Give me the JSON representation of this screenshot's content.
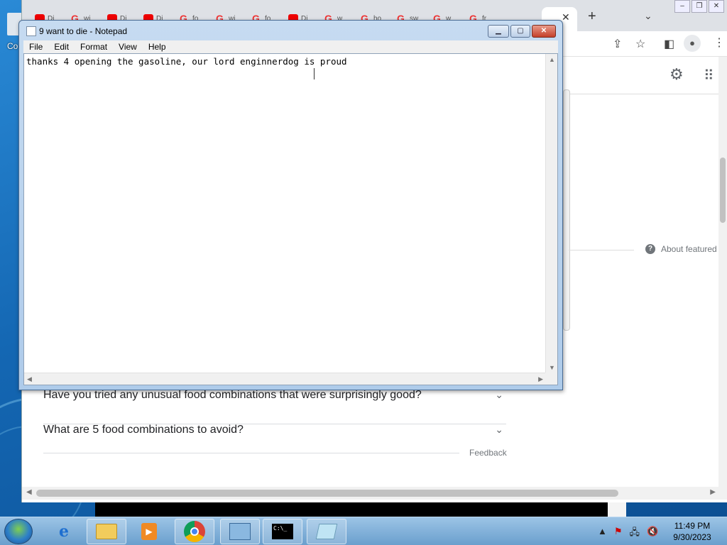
{
  "desktop": {
    "icon_label": "Co"
  },
  "chrome": {
    "tabs": [
      {
        "favicon": "youtube",
        "label": "Di"
      },
      {
        "favicon": "google",
        "label": "wi"
      },
      {
        "favicon": "youtube",
        "label": "Di"
      },
      {
        "favicon": "youtube",
        "label": "Di"
      },
      {
        "favicon": "google",
        "label": "fo"
      },
      {
        "favicon": "google",
        "label": "wi"
      },
      {
        "favicon": "google",
        "label": "fo"
      },
      {
        "favicon": "youtube",
        "label": "Di"
      },
      {
        "favicon": "google",
        "label": "w"
      },
      {
        "favicon": "google",
        "label": "ho"
      },
      {
        "favicon": "google",
        "label": "sw"
      },
      {
        "favicon": "google",
        "label": "w"
      },
      {
        "favicon": "google",
        "label": "fr"
      }
    ],
    "new_tab": "+",
    "tab_close": "✕",
    "tab_dropdown": "⌄",
    "about_featured": "About featured",
    "faq": [
      "Have you tried any unusual food combinations that were surprisingly good?",
      "What are 5 food combinations to avoid?"
    ],
    "feedback": "Feedback"
  },
  "notepad": {
    "title": "9 want to die - Notepad",
    "menu": [
      "File",
      "Edit",
      "Format",
      "View",
      "Help"
    ],
    "content": "thanks 4 opening the gasoline, our lord enginnerdog is proud"
  },
  "taskbar": {
    "time": "11:49 PM",
    "date": "9/30/2023"
  }
}
